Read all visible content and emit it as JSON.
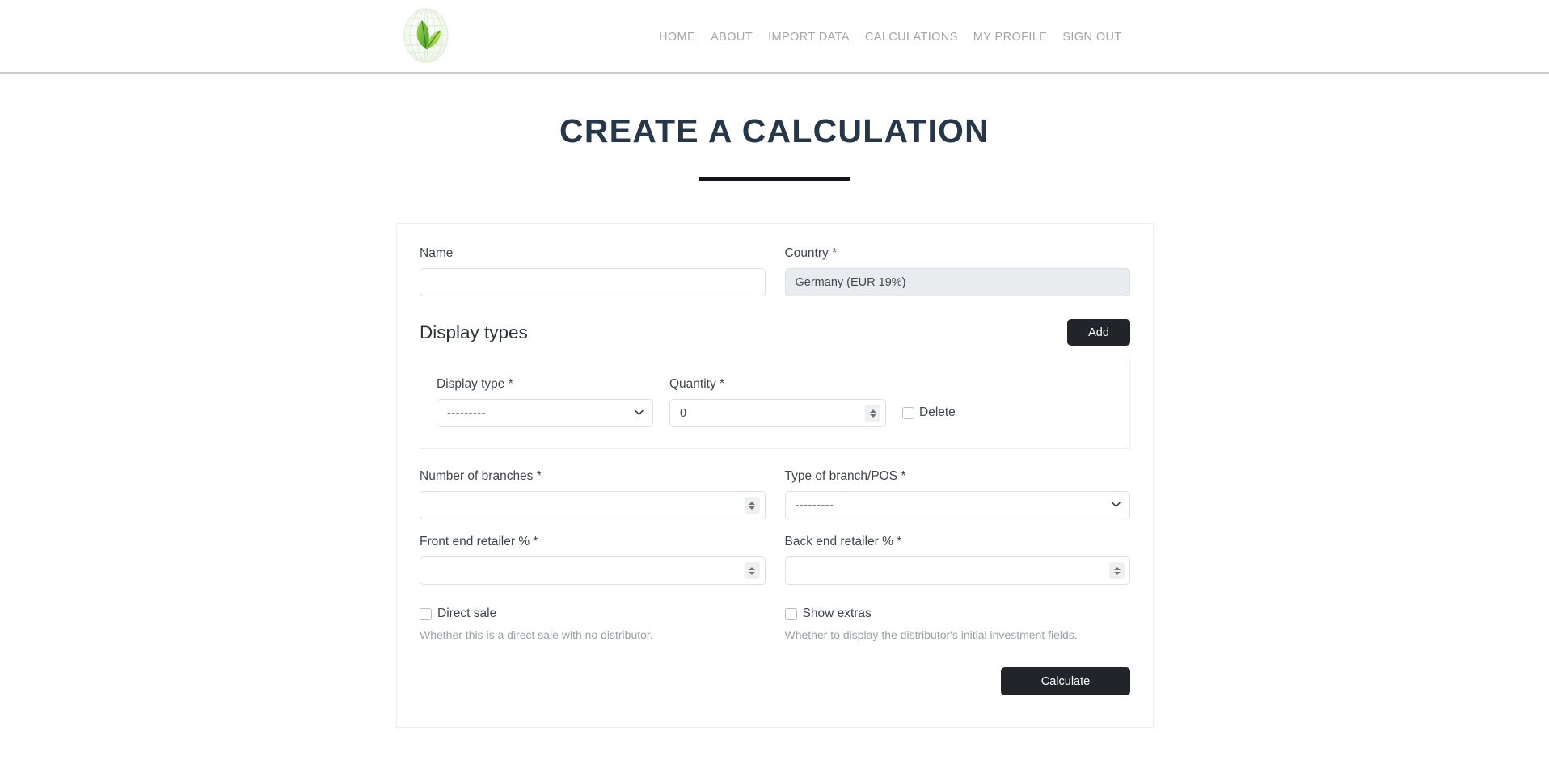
{
  "header": {
    "logo_icon": "leaf-globe-logo",
    "nav": [
      {
        "label": "HOME"
      },
      {
        "label": "ABOUT"
      },
      {
        "label": "IMPORT DATA"
      },
      {
        "label": "CALCULATIONS"
      },
      {
        "label": "MY PROFILE"
      },
      {
        "label": "SIGN OUT"
      }
    ]
  },
  "page": {
    "title": "CREATE A CALCULATION"
  },
  "form": {
    "name": {
      "label": "Name",
      "value": "",
      "placeholder": ""
    },
    "country": {
      "label": "Country *",
      "value": "Germany (EUR 19%)",
      "disabled": true
    },
    "display_types": {
      "section_title": "Display types",
      "add_label": "Add",
      "rows": [
        {
          "display_type": {
            "label": "Display type *",
            "value": "---------",
            "options": [
              "---------"
            ]
          },
          "quantity": {
            "label": "Quantity *",
            "value": "0"
          },
          "delete": {
            "label": "Delete",
            "checked": false
          }
        }
      ]
    },
    "number_of_branches": {
      "label": "Number of branches *",
      "value": "",
      "placeholder": ""
    },
    "type_of_branch": {
      "label": "Type of branch/POS *",
      "value": "---------",
      "options": [
        "---------"
      ]
    },
    "front_end_retailer": {
      "label": "Front end retailer % *",
      "value": "",
      "placeholder": ""
    },
    "back_end_retailer": {
      "label": "Back end retailer % *",
      "value": "",
      "placeholder": ""
    },
    "direct_sale": {
      "label": "Direct sale",
      "checked": false,
      "help": "Whether this is a direct sale with no distributor."
    },
    "show_extras": {
      "label": "Show extras",
      "checked": false,
      "help": "Whether to display the distributor's initial investment fields."
    },
    "calculate_label": "Calculate"
  },
  "colors": {
    "title": "#27374a",
    "button_dark": "#212529",
    "nav_text": "#a6a6a6",
    "disabled_field": "#e9ecef",
    "rule": "#111418"
  }
}
